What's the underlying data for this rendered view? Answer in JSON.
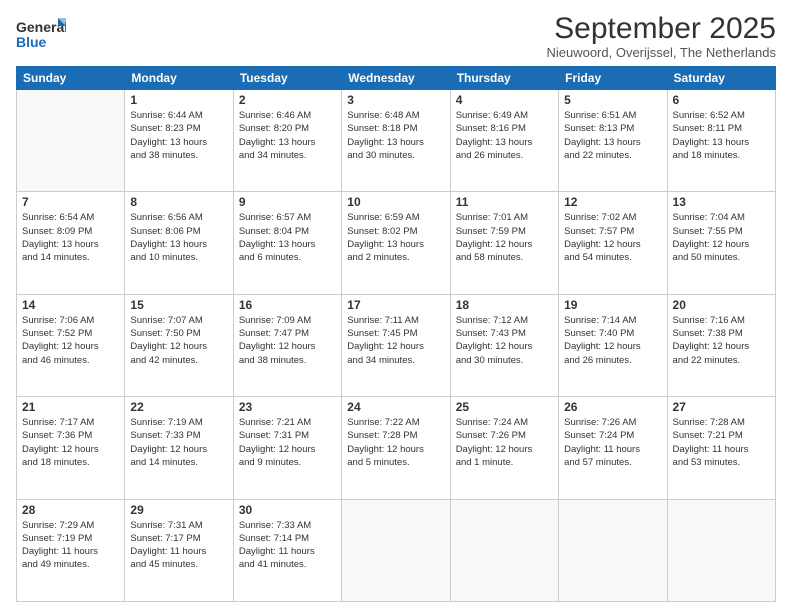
{
  "logo": {
    "line1": "General",
    "line2": "Blue"
  },
  "title": "September 2025",
  "subtitle": "Nieuwoord, Overijssel, The Netherlands",
  "weekdays": [
    "Sunday",
    "Monday",
    "Tuesday",
    "Wednesday",
    "Thursday",
    "Friday",
    "Saturday"
  ],
  "weeks": [
    [
      {
        "day": "",
        "info": ""
      },
      {
        "day": "1",
        "info": "Sunrise: 6:44 AM\nSunset: 8:23 PM\nDaylight: 13 hours\nand 38 minutes."
      },
      {
        "day": "2",
        "info": "Sunrise: 6:46 AM\nSunset: 8:20 PM\nDaylight: 13 hours\nand 34 minutes."
      },
      {
        "day": "3",
        "info": "Sunrise: 6:48 AM\nSunset: 8:18 PM\nDaylight: 13 hours\nand 30 minutes."
      },
      {
        "day": "4",
        "info": "Sunrise: 6:49 AM\nSunset: 8:16 PM\nDaylight: 13 hours\nand 26 minutes."
      },
      {
        "day": "5",
        "info": "Sunrise: 6:51 AM\nSunset: 8:13 PM\nDaylight: 13 hours\nand 22 minutes."
      },
      {
        "day": "6",
        "info": "Sunrise: 6:52 AM\nSunset: 8:11 PM\nDaylight: 13 hours\nand 18 minutes."
      }
    ],
    [
      {
        "day": "7",
        "info": "Sunrise: 6:54 AM\nSunset: 8:09 PM\nDaylight: 13 hours\nand 14 minutes."
      },
      {
        "day": "8",
        "info": "Sunrise: 6:56 AM\nSunset: 8:06 PM\nDaylight: 13 hours\nand 10 minutes."
      },
      {
        "day": "9",
        "info": "Sunrise: 6:57 AM\nSunset: 8:04 PM\nDaylight: 13 hours\nand 6 minutes."
      },
      {
        "day": "10",
        "info": "Sunrise: 6:59 AM\nSunset: 8:02 PM\nDaylight: 13 hours\nand 2 minutes."
      },
      {
        "day": "11",
        "info": "Sunrise: 7:01 AM\nSunset: 7:59 PM\nDaylight: 12 hours\nand 58 minutes."
      },
      {
        "day": "12",
        "info": "Sunrise: 7:02 AM\nSunset: 7:57 PM\nDaylight: 12 hours\nand 54 minutes."
      },
      {
        "day": "13",
        "info": "Sunrise: 7:04 AM\nSunset: 7:55 PM\nDaylight: 12 hours\nand 50 minutes."
      }
    ],
    [
      {
        "day": "14",
        "info": "Sunrise: 7:06 AM\nSunset: 7:52 PM\nDaylight: 12 hours\nand 46 minutes."
      },
      {
        "day": "15",
        "info": "Sunrise: 7:07 AM\nSunset: 7:50 PM\nDaylight: 12 hours\nand 42 minutes."
      },
      {
        "day": "16",
        "info": "Sunrise: 7:09 AM\nSunset: 7:47 PM\nDaylight: 12 hours\nand 38 minutes."
      },
      {
        "day": "17",
        "info": "Sunrise: 7:11 AM\nSunset: 7:45 PM\nDaylight: 12 hours\nand 34 minutes."
      },
      {
        "day": "18",
        "info": "Sunrise: 7:12 AM\nSunset: 7:43 PM\nDaylight: 12 hours\nand 30 minutes."
      },
      {
        "day": "19",
        "info": "Sunrise: 7:14 AM\nSunset: 7:40 PM\nDaylight: 12 hours\nand 26 minutes."
      },
      {
        "day": "20",
        "info": "Sunrise: 7:16 AM\nSunset: 7:38 PM\nDaylight: 12 hours\nand 22 minutes."
      }
    ],
    [
      {
        "day": "21",
        "info": "Sunrise: 7:17 AM\nSunset: 7:36 PM\nDaylight: 12 hours\nand 18 minutes."
      },
      {
        "day": "22",
        "info": "Sunrise: 7:19 AM\nSunset: 7:33 PM\nDaylight: 12 hours\nand 14 minutes."
      },
      {
        "day": "23",
        "info": "Sunrise: 7:21 AM\nSunset: 7:31 PM\nDaylight: 12 hours\nand 9 minutes."
      },
      {
        "day": "24",
        "info": "Sunrise: 7:22 AM\nSunset: 7:28 PM\nDaylight: 12 hours\nand 5 minutes."
      },
      {
        "day": "25",
        "info": "Sunrise: 7:24 AM\nSunset: 7:26 PM\nDaylight: 12 hours\nand 1 minute."
      },
      {
        "day": "26",
        "info": "Sunrise: 7:26 AM\nSunset: 7:24 PM\nDaylight: 11 hours\nand 57 minutes."
      },
      {
        "day": "27",
        "info": "Sunrise: 7:28 AM\nSunset: 7:21 PM\nDaylight: 11 hours\nand 53 minutes."
      }
    ],
    [
      {
        "day": "28",
        "info": "Sunrise: 7:29 AM\nSunset: 7:19 PM\nDaylight: 11 hours\nand 49 minutes."
      },
      {
        "day": "29",
        "info": "Sunrise: 7:31 AM\nSunset: 7:17 PM\nDaylight: 11 hours\nand 45 minutes."
      },
      {
        "day": "30",
        "info": "Sunrise: 7:33 AM\nSunset: 7:14 PM\nDaylight: 11 hours\nand 41 minutes."
      },
      {
        "day": "",
        "info": ""
      },
      {
        "day": "",
        "info": ""
      },
      {
        "day": "",
        "info": ""
      },
      {
        "day": "",
        "info": ""
      }
    ]
  ]
}
